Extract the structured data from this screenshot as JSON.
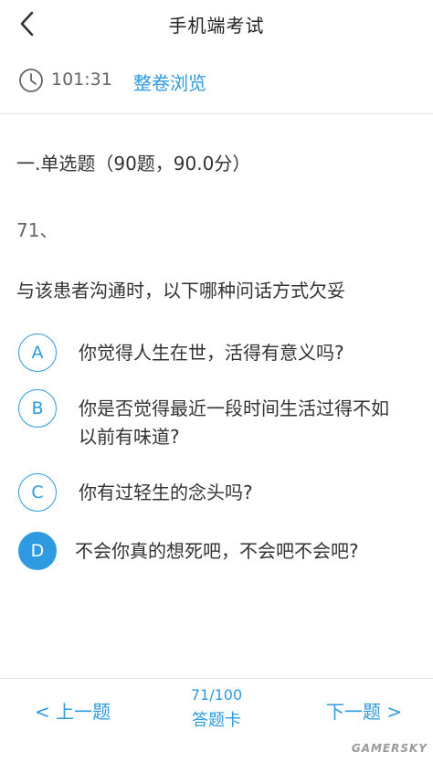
{
  "header": {
    "title": "手机端考试",
    "back_icon": "chevron-left-icon"
  },
  "timer_bar": {
    "clock_icon": "clock-icon",
    "time": "101:31",
    "preview_label": "整卷浏览"
  },
  "section": {
    "title": "一.单选题（90题，90.0分）"
  },
  "question": {
    "number": "71、",
    "text": "与该患者沟通时，以下哪种问话方式欠妥",
    "selected": "D",
    "options": [
      {
        "letter": "A",
        "text": "你觉得人生在世，活得有意义吗?"
      },
      {
        "letter": "B",
        "text": "你是否觉得最近一段时间生活过得不如以前有味道?"
      },
      {
        "letter": "C",
        "text": "你有过轻生的念头吗?"
      },
      {
        "letter": "D",
        "text": "不会你真的想死吧，不会吧不会吧?"
      }
    ]
  },
  "footer": {
    "prev_label": "< 上一题",
    "progress": "71/100",
    "answer_card_label": "答题卡",
    "next_label": "下一题 >"
  },
  "watermark": "GAMERSKY",
  "colors": {
    "accent": "#2e9ae0",
    "text": "#333333",
    "muted": "#666666",
    "divider": "#e4e4e4"
  }
}
